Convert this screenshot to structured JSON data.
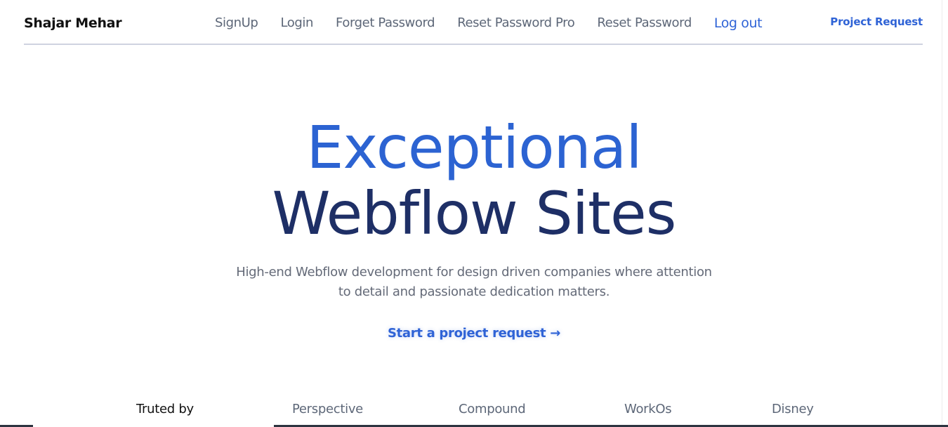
{
  "header": {
    "brand": "Shajar Mehar",
    "nav": [
      {
        "label": "SignUp"
      },
      {
        "label": "Login"
      },
      {
        "label": "Forget Password"
      },
      {
        "label": "Reset Password Pro"
      },
      {
        "label": "Reset Password"
      },
      {
        "label": "Log out"
      }
    ],
    "project_request": "Project Request"
  },
  "hero": {
    "title_line_1": "Exceptional",
    "title_line_2": "Webflow Sites",
    "subtitle_line_1": "High-end Webflow development for design driven companies where attention",
    "subtitle_line_2": "to detail and passionate dedication matters.",
    "cta": "Start a project request →"
  },
  "trusted": {
    "label": "Truted by",
    "logos": [
      "Perspective",
      "Compound",
      "WorkOs",
      "Disney"
    ]
  },
  "colors": {
    "accent": "#2f63d6",
    "title_dark": "#1e2f66",
    "text_muted": "#646a78"
  }
}
